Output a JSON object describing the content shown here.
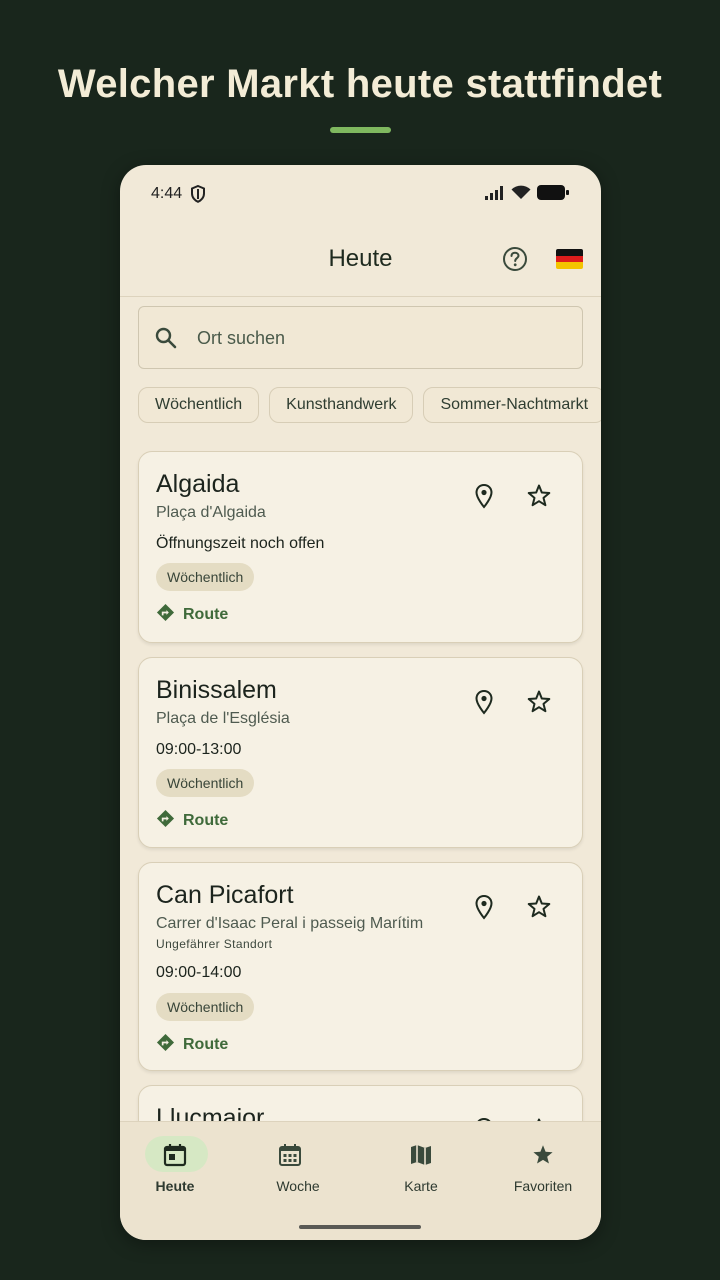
{
  "promo": {
    "title": "Welcher Markt heute stattfindet"
  },
  "status": {
    "time": "4:44"
  },
  "app_bar": {
    "title": "Heute"
  },
  "search": {
    "placeholder": "Ort suchen"
  },
  "chips": [
    "Wöchentlich",
    "Kunsthandwerk",
    "Sommer-Nachtmarkt"
  ],
  "markets": [
    {
      "name": "Algaida",
      "place": "Plaça d'Algaida",
      "approx": "",
      "time": "Öffnungszeit noch offen",
      "tag": "Wöchentlich",
      "route": "Route"
    },
    {
      "name": "Binissalem",
      "place": "Plaça de l'Església",
      "approx": "",
      "time": "09:00-13:00",
      "tag": "Wöchentlich",
      "route": "Route"
    },
    {
      "name": "Can Picafort",
      "place": "Carrer d'Isaac Peral i passeig Marítim",
      "approx": "Ungefährer Standort",
      "time": "09:00-14:00",
      "tag": "Wöchentlich",
      "route": "Route"
    },
    {
      "name": "Llucmajor"
    }
  ],
  "nav": [
    {
      "label": "Heute",
      "icon": "calendar-today-icon",
      "active": true
    },
    {
      "label": "Woche",
      "icon": "calendar-week-icon",
      "active": false
    },
    {
      "label": "Karte",
      "icon": "map-icon",
      "active": false
    },
    {
      "label": "Favoriten",
      "icon": "star-icon",
      "active": false
    }
  ],
  "colors": {
    "background": "#19261c",
    "accent": "#7fb85f",
    "route_green": "#3f6a3a",
    "surface": "#f1e9d8"
  }
}
